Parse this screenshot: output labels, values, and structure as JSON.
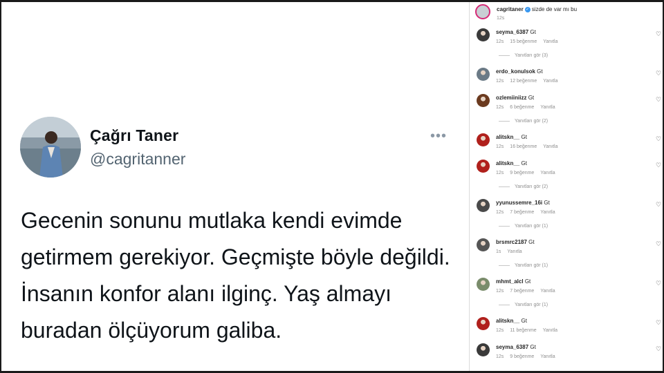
{
  "tweet": {
    "name": "Çağrı Taner",
    "handle": "@cagritanner",
    "more": "•••",
    "text": "Gecenin sonunu mutlaka kendi evimde getirmem gerekiyor. Geçmişte böyle değildi. İnsanın konfor alanı ilginç. Yaş almayı buradan ölçüyorum galiba."
  },
  "caption": {
    "user": "cagritaner",
    "text": "sizde de var mı bu",
    "time": "12s"
  },
  "labels": {
    "like": "♡"
  },
  "comments": [
    {
      "user": "seyma_6387",
      "text": "Gt",
      "time": "12s",
      "likes": "15 beğenme",
      "reply": "Yanıtla",
      "view_replies": "Yanıtları gör (3)",
      "avatar_color": "#3a3a3a"
    },
    {
      "user": "erdo_konulsok",
      "text": "Gt",
      "time": "12s",
      "likes": "12 beğenme",
      "reply": "Yanıtla",
      "view_replies": "",
      "avatar_color": "#6b7a86"
    },
    {
      "user": "ozlemiiniizz",
      "text": "Gt",
      "time": "12s",
      "likes": "6 beğenme",
      "reply": "Yanıtla",
      "view_replies": "Yanıtları gör (2)",
      "avatar_color": "#6b3a1f"
    },
    {
      "user": "alitskn__",
      "text": "Gt",
      "time": "12s",
      "likes": "16 beğenme",
      "reply": "Yanıtla",
      "view_replies": "",
      "avatar_color": "#b0201c"
    },
    {
      "user": "alitskn__",
      "text": "Gt",
      "time": "12s",
      "likes": "9 beğenme",
      "reply": "Yanıtla",
      "view_replies": "Yanıtları gör (2)",
      "avatar_color": "#b0201c"
    },
    {
      "user": "yyunussemre_16i",
      "text": "Gt",
      "time": "12s",
      "likes": "7 beğenme",
      "reply": "Yanıtla",
      "view_replies": "Yanıtları gör (1)",
      "avatar_color": "#4a4a4a"
    },
    {
      "user": "brsmrc2187",
      "text": "Gt",
      "time": "1s",
      "likes": "",
      "reply": "Yanıtla",
      "view_replies": "Yanıtları gör (1)",
      "avatar_color": "#555555"
    },
    {
      "user": "mhmt_alcl",
      "text": "Gt",
      "time": "12s",
      "likes": "7 beğenme",
      "reply": "Yanıtla",
      "view_replies": "Yanıtları gör (1)",
      "avatar_color": "#7a8c6b"
    },
    {
      "user": "alitskn__",
      "text": "Gt",
      "time": "12s",
      "likes": "11 beğenme",
      "reply": "Yanıtla",
      "view_replies": "",
      "avatar_color": "#b0201c"
    },
    {
      "user": "seyma_6387",
      "text": "Gt",
      "time": "12s",
      "likes": "9 beğenme",
      "reply": "Yanıtla",
      "view_replies": "",
      "avatar_color": "#3a3a3a"
    }
  ]
}
